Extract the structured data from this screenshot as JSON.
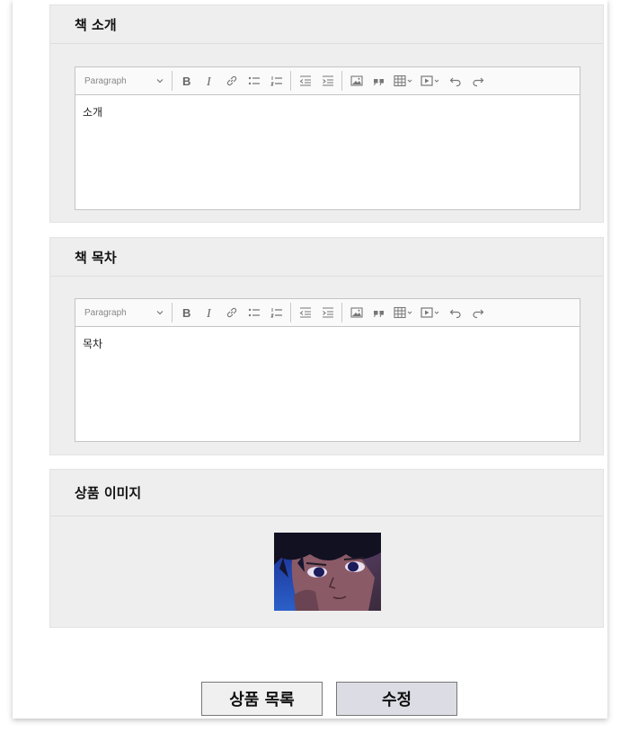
{
  "sections": {
    "intro": {
      "title": "책 소개",
      "toolbar": {
        "format": "Paragraph"
      },
      "content": "소개"
    },
    "toc": {
      "title": "책 목차",
      "toolbar": {
        "format": "Paragraph"
      },
      "content": "목차"
    },
    "image": {
      "title": "상품 이미지"
    }
  },
  "buttons": {
    "list_label": "상품 목록",
    "edit_label": "수정"
  },
  "toolbar_icons": [
    "bold-icon",
    "italic-icon",
    "link-icon",
    "bulleted-list-icon",
    "numbered-list-icon",
    "outdent-icon",
    "indent-icon",
    "image-icon",
    "blockquote-icon",
    "table-icon",
    "media-icon",
    "undo-icon",
    "redo-icon"
  ],
  "colors": {
    "section_bg": "#eeeeee",
    "editor_border": "#c4c4c4",
    "edit_button_bg": "#dcdce4",
    "list_button_bg": "#f0f0f0"
  }
}
